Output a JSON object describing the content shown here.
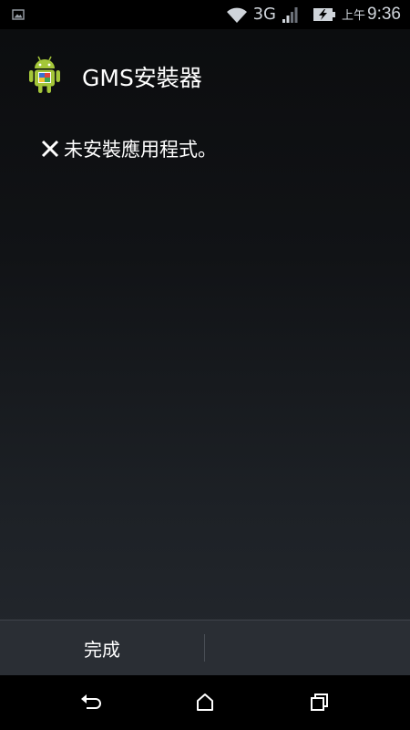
{
  "status_bar": {
    "notification_icon": "image-icon",
    "wifi_icon": "wifi-icon",
    "network_type": "3G",
    "signal_icon": "signal-icon",
    "battery_icon": "battery-charging-icon",
    "ampm": "上午",
    "time": "9:36"
  },
  "header": {
    "app_icon": "android-icon",
    "title": "GMS安裝器"
  },
  "message": {
    "icon": "close-icon",
    "text": "未安裝應用程式。"
  },
  "button_bar": {
    "done_label": "完成"
  },
  "nav_bar": {
    "back_icon": "back-icon",
    "home_icon": "home-icon",
    "recents_icon": "recents-icon"
  },
  "colors": {
    "text": "#ffffff",
    "status_text": "#cfd4da",
    "android_green": "#a4c639",
    "button_bar_bg": "#2a2e34"
  }
}
